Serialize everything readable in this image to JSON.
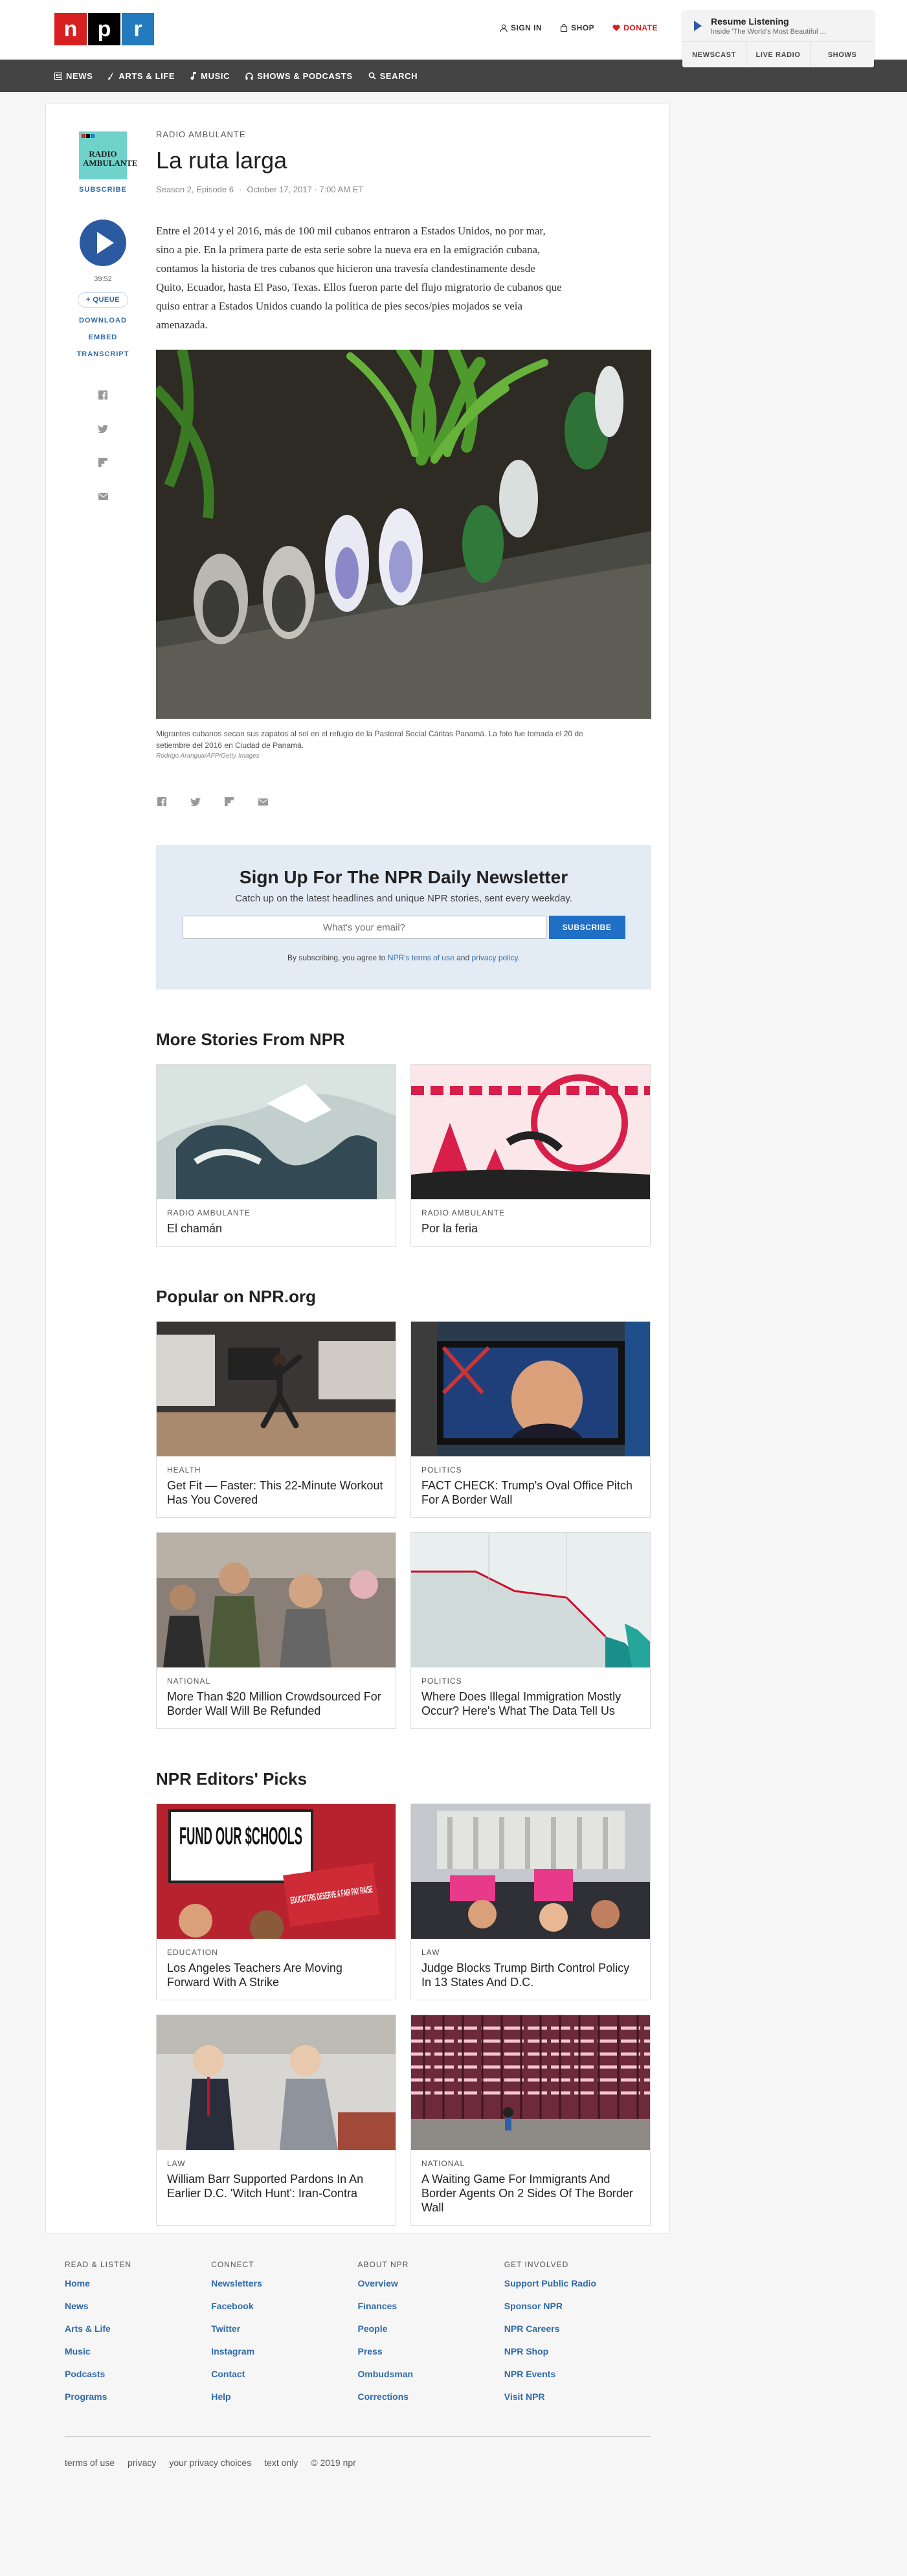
{
  "header": {
    "logo": [
      "n",
      "p",
      "r"
    ],
    "logo_colors": [
      "#d62021",
      "#000000",
      "#237bbd"
    ],
    "utility": {
      "sign_in": "SIGN IN",
      "shop": "SHOP",
      "donate": "DONATE"
    },
    "player": {
      "title": "Resume Listening",
      "subtitle": "Inside 'The World's Most Beautiful ...",
      "tabs": [
        "NEWSCAST",
        "LIVE RADIO",
        "SHOWS"
      ]
    },
    "nav": [
      "NEWS",
      "ARTS & LIFE",
      "MUSIC",
      "SHOWS & PODCASTS",
      "SEARCH"
    ]
  },
  "sidebar": {
    "program_art": "RADIO AMBULANTE",
    "subscribe": "SUBSCRIBE",
    "duration": "39:52",
    "queue": "+ QUEUE",
    "links": [
      "DOWNLOAD",
      "EMBED",
      "TRANSCRIPT"
    ]
  },
  "story": {
    "slug": "RADIO AMBULANTE",
    "title": "La ruta larga",
    "episode": "Season 2, Episode 6",
    "date": "October 17, 2017 · 7:00 AM ET",
    "teaser": "Entre el 2014 y el 2016, más de 100 mil cubanos entraron a Estados Unidos, no por mar, sino a pie. En la primera parte de esta serie sobre la nueva era en la emigración cubana, contamos la historia de tres cubanos que hicieron una travesía clandestinamente desde Quito, Ecuador, hasta El Paso, Texas. Ellos fueron parte del flujo migratorio de cubanos que quiso entrar a Estados Unidos cuando la política de pies secos/pies mojados se veía amenazada.",
    "caption": "Migrantes cubanos secan sus zapatos al sol en el refugio de la Pastoral Social Cáritas Panamá. La foto fue tomada el 20 de setiembre del 2016 en Ciudad de Panamá.",
    "credit": "Rodrigo Arangua/AFP/Getty Images"
  },
  "newsletter": {
    "title": "Sign Up For The NPR Daily Newsletter",
    "subtitle": "Catch up on the latest headlines and unique NPR stories, sent every weekday.",
    "placeholder": "What's your email?",
    "button": "SUBSCRIBE",
    "legal_pre": "By subscribing, you agree to ",
    "legal_link1": "NPR's terms of use",
    "legal_mid": " and ",
    "legal_link2": "privacy policy",
    "legal_end": "."
  },
  "more_stories": {
    "title": "More Stories From NPR",
    "items": [
      {
        "kicker": "RADIO AMBULANTE",
        "title": "El chamán"
      },
      {
        "kicker": "RADIO AMBULANTE",
        "title": "Por la feria"
      }
    ]
  },
  "popular": {
    "title": "Popular on NPR.org",
    "items": [
      {
        "kicker": "HEALTH",
        "title": "Get Fit — Faster: This 22-Minute Workout Has You Covered"
      },
      {
        "kicker": "POLITICS",
        "title": "FACT CHECK: Trump's Oval Office Pitch For A Border Wall"
      },
      {
        "kicker": "NATIONAL",
        "title": "More Than $20 Million Crowdsourced For Border Wall Will Be Refunded"
      },
      {
        "kicker": "POLITICS",
        "title": "Where Does Illegal Immigration Mostly Occur? Here's What The Data Tell Us"
      }
    ]
  },
  "editors": {
    "title": "NPR Editors' Picks",
    "items": [
      {
        "kicker": "EDUCATION",
        "title": "Los Angeles Teachers Are Moving Forward With A Strike"
      },
      {
        "kicker": "LAW",
        "title": "Judge Blocks Trump Birth Control Policy In 13 States And D.C."
      },
      {
        "kicker": "LAW",
        "title": "William Barr Supported Pardons In An Earlier D.C. 'Witch Hunt': Iran-Contra"
      },
      {
        "kicker": "NATIONAL",
        "title": "A Waiting Game For Immigrants And Border Agents On 2 Sides Of The Border Wall"
      }
    ]
  },
  "image_text": {
    "sign1": "FUND OUR $CHOOLS",
    "sign2": "EDUCATORS DESERVE A FAIR PAY RAISE"
  },
  "footer": {
    "columns": [
      {
        "head": "READ & LISTEN",
        "links": [
          "Home",
          "News",
          "Arts & Life",
          "Music",
          "Podcasts",
          "Programs"
        ]
      },
      {
        "head": "CONNECT",
        "links": [
          "Newsletters",
          "Facebook",
          "Twitter",
          "Instagram",
          "Contact",
          "Help"
        ]
      },
      {
        "head": "ABOUT NPR",
        "links": [
          "Overview",
          "Finances",
          "People",
          "Press",
          "Ombudsman",
          "Corrections"
        ]
      },
      {
        "head": "GET INVOLVED",
        "links": [
          "Support Public Radio",
          "Sponsor NPR",
          "NPR Careers",
          "NPR Shop",
          "NPR Events",
          "Visit NPR"
        ]
      }
    ],
    "bottom": [
      "terms of use",
      "privacy",
      "your privacy choices",
      "text only",
      "© 2019 npr"
    ]
  },
  "colors": {
    "npr_red": "#d62021",
    "npr_blue": "#237bbd",
    "link_blue": "#2f6aab",
    "play_blue": "#2c5aa0",
    "nav_bg": "#444444",
    "newsletter_bg": "#e3ebf4"
  }
}
